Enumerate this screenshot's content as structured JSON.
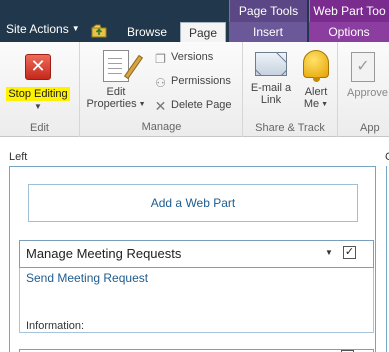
{
  "topbar": {
    "site_actions": "Site Actions",
    "context_groups": {
      "page_tools": "Page Tools",
      "web_part_tools": "Web Part Too"
    },
    "tabs": [
      {
        "label": "Browse",
        "selected": false
      },
      {
        "label": "Page",
        "selected": true
      },
      {
        "label": "Insert",
        "selected": false
      },
      {
        "label": "Options",
        "selected": false
      }
    ]
  },
  "ribbon": {
    "groups": {
      "edit": {
        "label": "Edit",
        "stop_editing": "Stop Editing"
      },
      "manage": {
        "label": "Manage",
        "edit_properties_line1": "Edit",
        "edit_properties_line2": "Properties",
        "versions": "Versions",
        "permissions": "Permissions",
        "delete_page": "Delete Page"
      },
      "share_track": {
        "label": "Share & Track",
        "email_line1": "E-mail a",
        "email_line2": "Link",
        "alert_line1": "Alert",
        "alert_line2": "Me"
      },
      "approval": {
        "label": "App",
        "approve": "Approve"
      }
    }
  },
  "zone": {
    "title": "Left",
    "right_title": "C",
    "add_web_part": "Add a Web Part",
    "web_part": {
      "title": "Manage Meeting Requests",
      "checked": true,
      "link": "Send Meeting Request",
      "info_label": "Information:"
    }
  },
  "colors": {
    "topbar_bg": "#21374c",
    "page_tools": "#5b4785",
    "web_part_tools": "#7a2b8e",
    "highlight": "#fff200",
    "link": "#1f5c8f"
  }
}
